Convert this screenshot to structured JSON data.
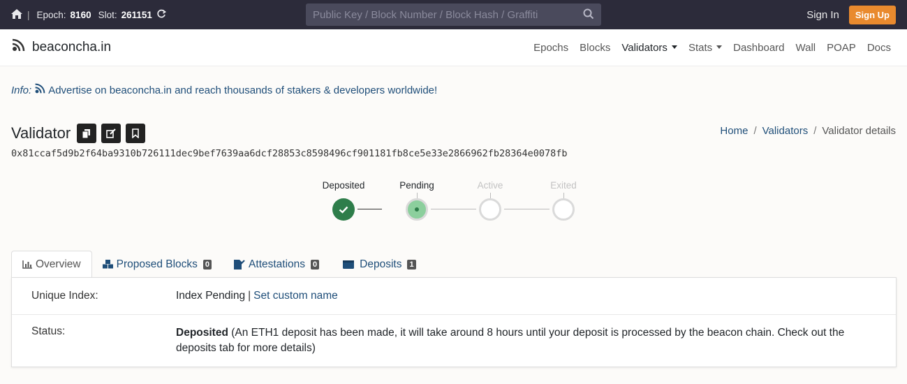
{
  "topbar": {
    "epoch_label": "Epoch:",
    "epoch": "8160",
    "slot_label": "Slot:",
    "slot": "261151",
    "search_placeholder": "Public Key / Block Number / Block Hash / Graffiti",
    "signin": "Sign In",
    "signup": "Sign Up"
  },
  "nav": {
    "brand": "beaconcha.in",
    "links": [
      "Epochs",
      "Blocks",
      "Validators",
      "Stats",
      "Dashboard",
      "Wall",
      "POAP",
      "Docs"
    ]
  },
  "info": {
    "label": "Info:",
    "text": "Advertise on beaconcha.in and reach thousands of stakers & developers worldwide!"
  },
  "validator": {
    "title": "Validator",
    "pubkey": "0x81ccaf5d9b2f64ba9310b726111dec9bef7639aa6dcf28853c8598496cf901181fb8ce5e33e2866962fb28364e0078fb"
  },
  "breadcrumb": [
    "Home",
    "Validators",
    "Validator details"
  ],
  "steps": [
    "Deposited",
    "Pending",
    "Active",
    "Exited"
  ],
  "tabs": [
    {
      "label": "Overview",
      "count": ""
    },
    {
      "label": "Proposed Blocks",
      "count": "0"
    },
    {
      "label": "Attestations",
      "count": "0"
    },
    {
      "label": "Deposits",
      "count": "1"
    }
  ],
  "overview": {
    "index_label": "Unique Index:",
    "index_value": "Index Pending",
    "custom_name": "Set custom name",
    "status_label": "Status:",
    "status_bold": "Deposited",
    "status_text": "(An ETH1 deposit has been made, it will take around 8 hours until your deposit is processed by the beacon chain. Check out the deposits tab for more details)"
  },
  "colors": {
    "topbar": "#2c2b3a",
    "signup": "#e98a2e",
    "link": "#1f4e79",
    "done": "#2e7d4a",
    "pending": "#8ccf9d"
  }
}
